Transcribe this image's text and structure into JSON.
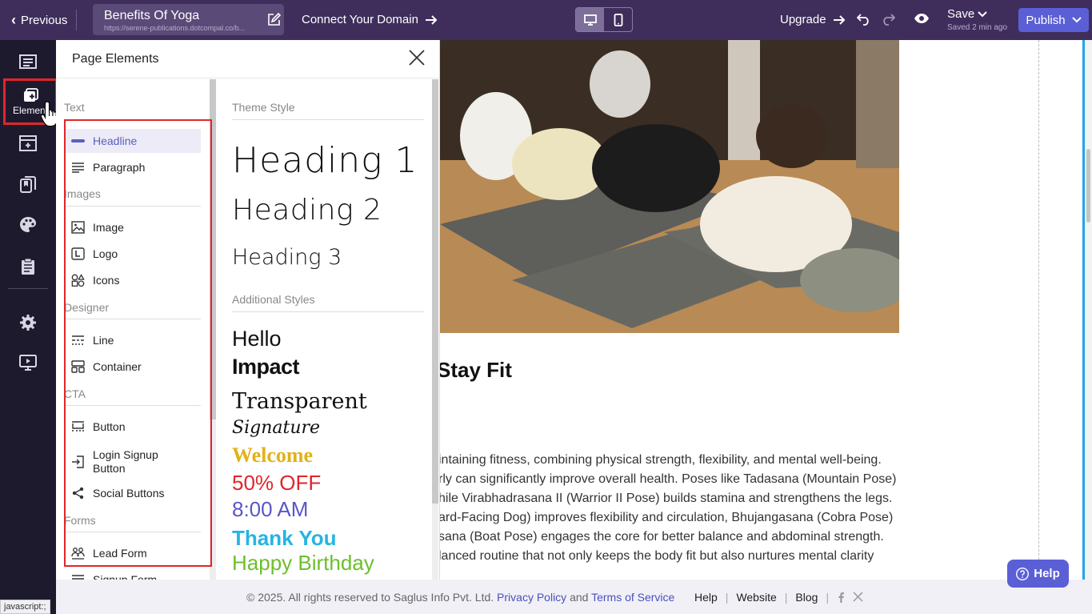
{
  "topbar": {
    "previous_label": "Previous",
    "site_title": "Benefits Of Yoga",
    "site_url": "https://serene-publications.dotcompal.co/b...",
    "connect_domain_label": "Connect Your Domain",
    "upgrade_label": "Upgrade",
    "save_label": "Save",
    "saved_ago": "Saved 2 min ago",
    "publish_label": "Publish",
    "active_device": "desktop"
  },
  "rail": {
    "active_label": "Element"
  },
  "panel": {
    "title": "Page Elements",
    "categories": {
      "text": "Text",
      "images": "Images",
      "designer": "Designer",
      "cta": "CTA",
      "forms": "Forms"
    },
    "items": {
      "headline": "Headline",
      "paragraph": "Paragraph",
      "image": "Image",
      "logo": "Logo",
      "icons": "Icons",
      "line": "Line",
      "container": "Container",
      "button": "Button",
      "login_signup_1": "Login Signup",
      "login_signup_2": "Button",
      "social_buttons": "Social Buttons",
      "lead_form": "Lead Form",
      "signup_form": "Signup Form"
    },
    "styles": {
      "theme_heading": "Theme Style",
      "heading1": "Heading 1",
      "heading2": "Heading 2",
      "heading3": "Heading 3",
      "additional_heading": "Additional Styles",
      "hello": "Hello",
      "impact": "Impact",
      "transparent": "Transparent",
      "signature": "Signature",
      "welcome": "Welcome",
      "off": "50% OFF",
      "time": "8:00 AM",
      "thanks": "Thank You",
      "birthday": "Happy Birthday"
    }
  },
  "canvas": {
    "heading": "Stay Fit",
    "lines": [
      "intaining fitness, combining physical strength, flexibility, and mental well-being.",
      "rly can significantly improve overall health. Poses like Tadasana (Mountain Pose)",
      "hile Virabhadrasana II (Warrior II Pose) builds stamina and strengthens the legs.",
      "ard-Facing Dog) improves flexibility and circulation, Bhujangasana (Cobra Pose)",
      "sana (Boat Pose) engages the core for better balance and abdominal strength.",
      "lanced routine that not only keeps the body fit but also nurtures mental clarity"
    ]
  },
  "footer": {
    "copyright": "©  2025. All rights reserved to Saglus Info Pvt. Ltd.",
    "privacy": "Privacy Policy",
    "and": "and",
    "terms": "Terms of Service",
    "help": "Help",
    "website": "Website",
    "blog": "Blog",
    "sep": "|"
  },
  "help_button": "Help",
  "status_url": "javascript:;",
  "colors": {
    "topbar": "#3f2e5c",
    "rail": "#1e1a2e",
    "accent": "#5b5fd6",
    "highlight": "#e0262a"
  }
}
